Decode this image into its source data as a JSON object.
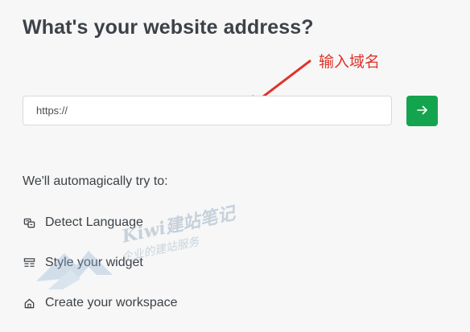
{
  "heading": "What's your website address?",
  "annotation": "输入域名",
  "url_input": {
    "placeholder": "https://"
  },
  "submit_icon": "arrow-right-icon",
  "intro": "We'll automagically try to:",
  "features": [
    {
      "label": "Detect Language",
      "icon": "translate-icon"
    },
    {
      "label": "Style your widget",
      "icon": "layout-icon"
    },
    {
      "label": "Create your workspace",
      "icon": "home-icon"
    }
  ],
  "watermark": {
    "line1": "Kiwi建站笔记",
    "line2": "企业的建站服务"
  },
  "colors": {
    "accent": "#14a44d",
    "annotation": "#e0332a",
    "text": "#3d4249"
  }
}
